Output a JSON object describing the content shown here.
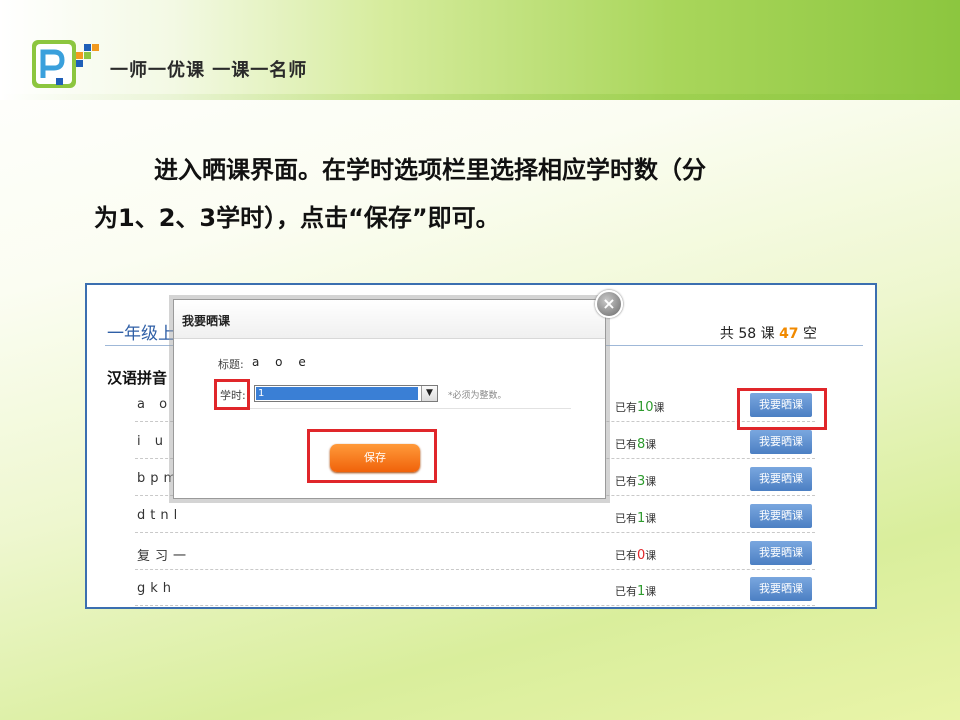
{
  "header": {
    "logo_text": "一师一优课 一课一名师"
  },
  "instruction": {
    "line1": "进入晒课界面。在学时选项栏里选择相应学时数（分",
    "line2": "为1、2、3学时），点击“保存”即可。"
  },
  "screenshot": {
    "grade_title": "一年级上",
    "totals": {
      "prefix": "共 58 课",
      "num": "47",
      "suffix": "空"
    },
    "unit_title": "汉语拼音",
    "rows": [
      {
        "lesson": "a o",
        "count_pre": "已有",
        "count": "10",
        "count_post": "课",
        "button": "我要晒课"
      },
      {
        "lesson": "i u",
        "count_pre": "已有",
        "count": "8",
        "count_post": "课",
        "button": "我要晒课"
      },
      {
        "lesson": "bpm",
        "count_pre": "已有",
        "count": "3",
        "count_post": "课",
        "button": "我要晒课"
      },
      {
        "lesson": "dtnl",
        "count_pre": "已有",
        "count": "1",
        "count_post": "课",
        "button": "我要晒课"
      },
      {
        "lesson": "复习一",
        "count_pre": "已有",
        "count": "0",
        "count_post": "课",
        "button": "我要晒课"
      },
      {
        "lesson": "gkh",
        "count_pre": "已有",
        "count": "1",
        "count_post": "课",
        "button": "我要晒课"
      }
    ],
    "dialog": {
      "title": "我要晒课",
      "close": "×",
      "title_label": "标题:",
      "title_value": "a o e",
      "hours_label": "学时:",
      "hours_value": "1",
      "hint": "*必须为整数。",
      "save": "保存"
    }
  },
  "colors": {
    "zero_count": "#e0262a",
    "count": "#2e9b2e",
    "highlight": "#e0262a",
    "accent": "#8cc63f"
  }
}
